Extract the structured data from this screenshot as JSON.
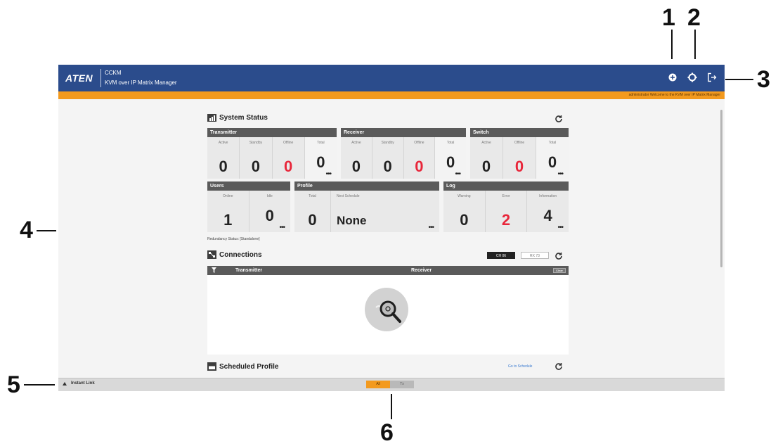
{
  "callouts": [
    "1",
    "2",
    "3",
    "4",
    "5",
    "6"
  ],
  "header": {
    "logo": "ATEN",
    "product_line1": "CCKM",
    "product_line2": "KVM over IP Matrix Manager",
    "icons": [
      "help-icon",
      "settings-icon",
      "logout-icon"
    ]
  },
  "status_message": "administrator Welcome to the KVM over IP Matrix Manager",
  "system_status": {
    "title": "System Status",
    "transmitter": {
      "title": "Transmitter",
      "stats": [
        {
          "label": "Active",
          "value": "0"
        },
        {
          "label": "Standby",
          "value": "0"
        },
        {
          "label": "Offline",
          "value": "0"
        },
        {
          "label": "Total",
          "value": "0"
        }
      ]
    },
    "receiver": {
      "title": "Receiver",
      "stats": [
        {
          "label": "Active",
          "value": "0"
        },
        {
          "label": "Standby",
          "value": "0"
        },
        {
          "label": "Offline",
          "value": "0"
        },
        {
          "label": "Total",
          "value": "0"
        }
      ]
    },
    "switch": {
      "title": "Switch",
      "stats": [
        {
          "label": "Active",
          "value": "0"
        },
        {
          "label": "Offline",
          "value": "0"
        },
        {
          "label": "Total",
          "value": "0"
        }
      ]
    },
    "users": {
      "title": "Users",
      "stats": [
        {
          "label": "Online",
          "value": "1"
        },
        {
          "label": "Idle",
          "value": "0"
        }
      ]
    },
    "profile": {
      "title": "Profile",
      "stats": [
        {
          "label": "Total",
          "value": "0"
        },
        {
          "label": "Next Schedule",
          "value": "None"
        }
      ]
    },
    "log": {
      "title": "Log",
      "stats": [
        {
          "label": "Warning",
          "value": "0"
        },
        {
          "label": "Error",
          "value": "2"
        },
        {
          "label": "Information",
          "value": "4"
        }
      ]
    }
  },
  "redundancy_status": "Redundancy Status: [Standalone]",
  "connections": {
    "title": "Connections",
    "toggle_on": "CH 06",
    "toggle_off": "RX 73",
    "col_transmitter": "Transmitter",
    "col_receiver": "Receiver",
    "header_button": "Clear"
  },
  "scheduled_profile": {
    "title": "Scheduled Profile",
    "link": "Go to Schedule"
  },
  "footer": {
    "instant_link": "Instant Link",
    "tab_active": "All",
    "tab_inactive": "Tx"
  },
  "colors": {
    "header_bg": "#2b4c8c",
    "status_orange": "#f39a1e",
    "alert_red": "#e8263a",
    "card_header": "#5a5a5a"
  }
}
